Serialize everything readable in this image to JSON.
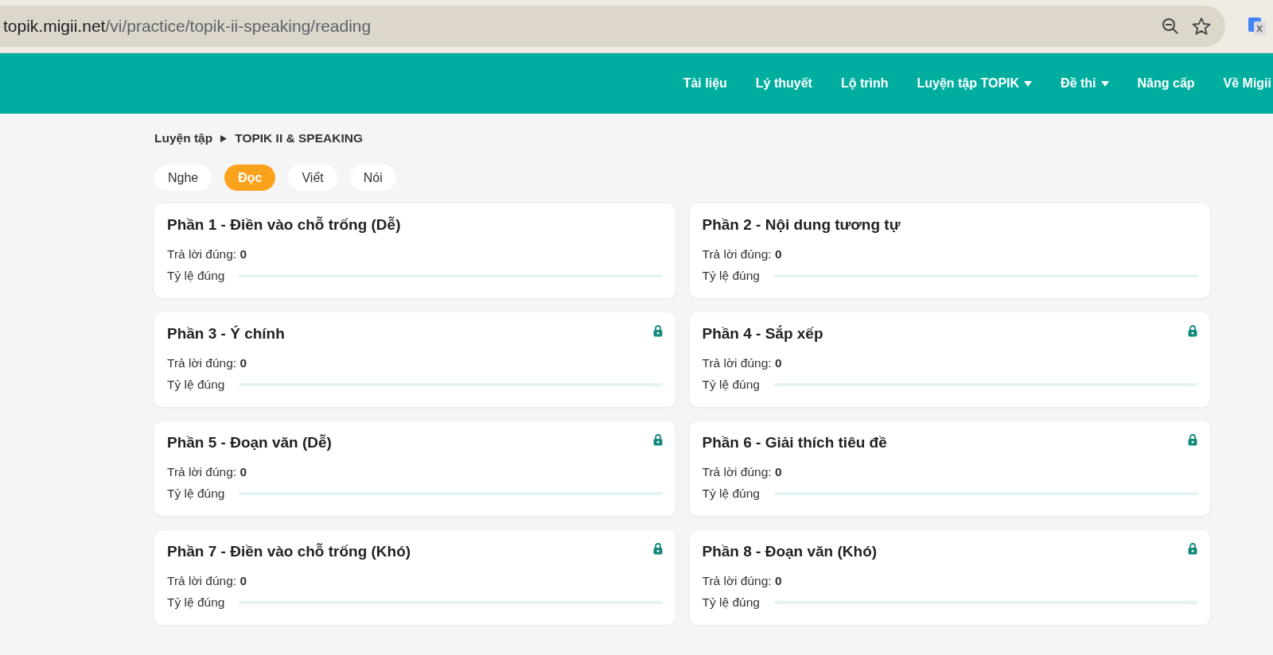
{
  "address_bar": {
    "host": "topik.migii.net",
    "path": "/vi/practice/topik-ii-speaking/reading"
  },
  "nav": [
    {
      "label": "Tài liệu",
      "dropdown": false
    },
    {
      "label": "Lý thuyết",
      "dropdown": false
    },
    {
      "label": "Lộ trình",
      "dropdown": false
    },
    {
      "label": "Luyện tập TOPIK",
      "dropdown": true
    },
    {
      "label": "Đề thi",
      "dropdown": true
    },
    {
      "label": "Nâng cấp",
      "dropdown": false
    },
    {
      "label": "Về Migii",
      "dropdown": false
    }
  ],
  "breadcrumb": [
    "Luyện tập",
    "TOPIK II & SPEAKING"
  ],
  "tabs": [
    {
      "label": "Nghe",
      "selected": false
    },
    {
      "label": "Đọc",
      "selected": true
    },
    {
      "label": "Viết",
      "selected": false
    },
    {
      "label": "Nói",
      "selected": false
    }
  ],
  "cards": [
    {
      "title": "Phần 1 - Điền vào chỗ trống (Dễ)",
      "locked": false,
      "correct_label": "Trả lời đúng:",
      "correct": "0",
      "rate_label": "Tỷ lệ đúng",
      "level": 0
    },
    {
      "title": "Phần 2 - Nội dung tương tự",
      "locked": false,
      "correct_label": "Trả lời đúng:",
      "correct": "0",
      "rate_label": "Tỷ lệ đúng",
      "level": 0
    },
    {
      "title": "Phần 3 - Ý chính",
      "locked": true,
      "correct_label": "Trả lời đúng:",
      "correct": "0",
      "rate_label": "Tỷ lệ đúng",
      "level": 0
    },
    {
      "title": "Phần 4 - Sắp xếp",
      "locked": true,
      "correct_label": "Trả lời đúng:",
      "correct": "0",
      "rate_label": "Tỷ lệ đúng",
      "level": 0
    },
    {
      "title": "Phần 5 - Đoạn văn (Dễ)",
      "locked": true,
      "correct_label": "Trả lời đúng:",
      "correct": "0",
      "rate_label": "Tỷ lệ đúng",
      "level": 0
    },
    {
      "title": "Phần 6 - Giải thích tiêu đề",
      "locked": true,
      "correct_label": "Trả lời đúng:",
      "correct": "0",
      "rate_label": "Tỷ lệ đúng",
      "level": 0
    },
    {
      "title": "Phần 7 - Điền vào chỗ trống (Khó)",
      "locked": true,
      "correct_label": "Trả lời đúng:",
      "correct": "0",
      "rate_label": "Tỷ lệ đúng",
      "level": 0
    },
    {
      "title": "Phần 8 - Đoạn văn (Khó)",
      "locked": true,
      "correct_label": "Trả lời đúng:",
      "correct": "0",
      "rate_label": "Tỷ lệ đúng",
      "level": 0
    }
  ]
}
